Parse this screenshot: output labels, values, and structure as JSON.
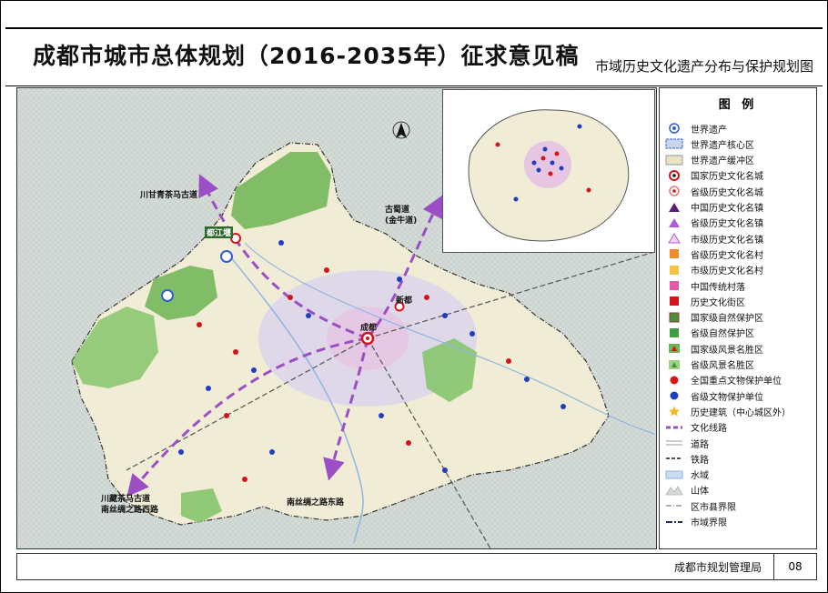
{
  "header": {
    "title": "成都市城市总体规划（2016-2035年）征求意见稿",
    "subtitle": "市域历史文化遗产分布与保护规划图"
  },
  "map": {
    "labels": {
      "route_nw": "川甘青茶马古道",
      "route_ne_line1": "古蜀道",
      "route_ne_line2": "(金牛道)",
      "route_sw_line1": "川藏茶马古道",
      "route_sw_line2": "南丝绸之路西路",
      "route_s": "南丝绸之路东路",
      "city_dujiangyan": "都江堰",
      "city_chengdu": "成都",
      "city_xindu": "新都"
    }
  },
  "legend": {
    "title": "图  例",
    "items": [
      {
        "label": "世界遗产",
        "symbol": "world-heritage"
      },
      {
        "label": "世界遗产核心区",
        "symbol": "wh-core"
      },
      {
        "label": "世界遗产缓冲区",
        "symbol": "wh-buffer"
      },
      {
        "label": "国家历史文化名城",
        "symbol": "national-city"
      },
      {
        "label": "省级历史文化名城",
        "symbol": "provincial-city"
      },
      {
        "label": "中国历史文化名镇",
        "symbol": "national-town"
      },
      {
        "label": "省级历史文化名镇",
        "symbol": "provincial-town"
      },
      {
        "label": "市级历史文化名镇",
        "symbol": "municipal-town"
      },
      {
        "label": "省级历史文化名村",
        "symbol": "provincial-village"
      },
      {
        "label": "市级历史文化名村",
        "symbol": "municipal-village"
      },
      {
        "label": "中国传统村落",
        "symbol": "traditional-village"
      },
      {
        "label": "历史文化街区",
        "symbol": "historic-district"
      },
      {
        "label": "国家级自然保护区",
        "symbol": "national-nature-reserve"
      },
      {
        "label": "省级自然保护区",
        "symbol": "provincial-nature-reserve"
      },
      {
        "label": "国家级风景名胜区",
        "symbol": "national-scenic-area"
      },
      {
        "label": "省级风景名胜区",
        "symbol": "provincial-scenic-area"
      },
      {
        "label": "全国重点文物保护单位",
        "symbol": "national-relic"
      },
      {
        "label": "省级文物保护单位",
        "symbol": "provincial-relic"
      },
      {
        "label": "历史建筑（中心城区外）",
        "symbol": "historic-building"
      },
      {
        "label": "文化线路",
        "symbol": "cultural-route"
      },
      {
        "label": "道路",
        "symbol": "road"
      },
      {
        "label": "铁路",
        "symbol": "railway"
      },
      {
        "label": "水域",
        "symbol": "water"
      },
      {
        "label": "山体",
        "symbol": "mountain"
      },
      {
        "label": "区市县界限",
        "symbol": "district-boundary"
      },
      {
        "label": "市域界限",
        "symbol": "city-boundary"
      }
    ]
  },
  "footer": {
    "agency": "成都市规划管理局",
    "page": "08"
  },
  "colors": {
    "route": "#9b4fc4",
    "region_fill": "#f3eedb",
    "center_fill": "#dcd0ec",
    "reserve_green": "#5aa545",
    "relic_red": "#d8141b",
    "relic_blue": "#1f3fbf"
  }
}
